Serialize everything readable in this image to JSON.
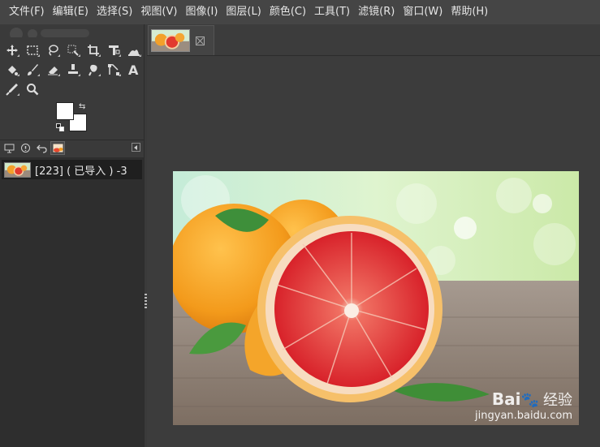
{
  "menubar": {
    "items": [
      "文件(F)",
      "编辑(E)",
      "选择(S)",
      "视图(V)",
      "图像(I)",
      "图层(L)",
      "颜色(C)",
      "工具(T)",
      "滤镜(R)",
      "窗口(W)",
      "帮助(H)"
    ]
  },
  "toolbox": {
    "rows": [
      [
        "move-tool-icon",
        "rect-select-tool-icon",
        "free-select-tool-icon",
        "fuzzy-select-tool-icon",
        "crop-tool-icon",
        "align-tool-icon",
        "warp-transform-tool-icon"
      ],
      [
        "bucket-fill-tool-icon",
        "paintbrush-tool-icon",
        "eraser-tool-icon",
        "clone-tool-icon",
        "smudge-tool-icon",
        "paths-tool-icon",
        "text-tool-icon"
      ],
      [
        "color-picker-tool-icon",
        "zoom-tool-icon"
      ]
    ],
    "foreground_color": "#ffffff",
    "background_color": "#ffffff"
  },
  "images_panel": {
    "tabs": [
      "device-status-icon",
      "error-console-icon",
      "undo-history-icon",
      "images-tab-icon"
    ],
    "items": [
      {
        "label": "[223] ( 已导入 ) -3"
      }
    ]
  },
  "canvas": {
    "watermark_brand": "Bai",
    "watermark_sub": "经验",
    "watermark_url": "jingyan.baidu.com"
  },
  "colors": {
    "menubar_bg": "#454545",
    "dock_bg": "#3a3a3a",
    "canvas_bg": "#3c3c3c",
    "selected_row_bg": "#1f1f1f"
  }
}
